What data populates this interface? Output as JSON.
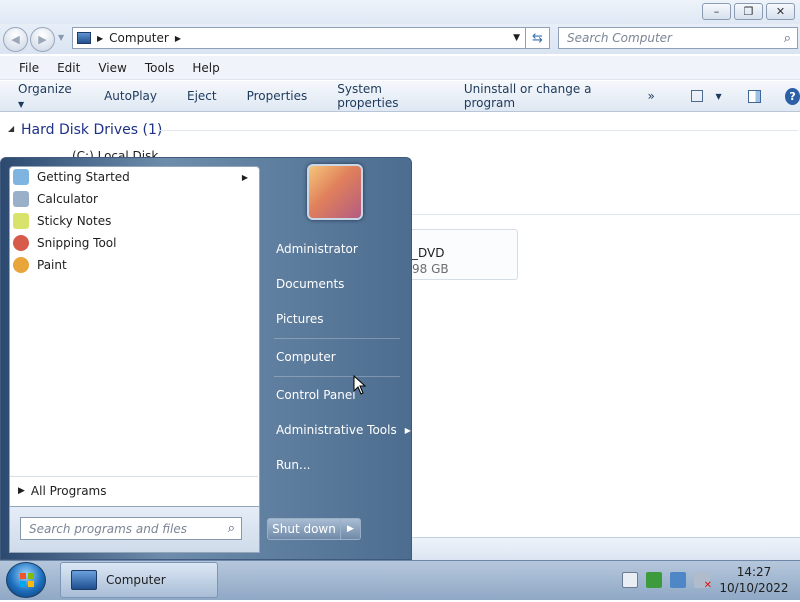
{
  "explorer": {
    "address": {
      "crumb": "Computer"
    },
    "search": {
      "placeholder": "Search Computer"
    },
    "menu": [
      "File",
      "Edit",
      "View",
      "Tools",
      "Help"
    ],
    "commands": [
      "Organize",
      "AutoPlay",
      "Eject",
      "Properties",
      "System properties",
      "Uninstall or change a program"
    ],
    "more": "»",
    "section": {
      "title": "Hard Disk Drives (1)"
    },
    "drive_c": {
      "label": "(C:) Local Disk"
    },
    "drive_dvd": {
      "label": "_DVD",
      "size": "98 GB"
    }
  },
  "start_menu": {
    "programs": [
      {
        "label": "Getting Started",
        "icon": "getting-started-icon",
        "color": "#7fb3e0"
      },
      {
        "label": "Calculator",
        "icon": "calculator-icon",
        "color": "#9ab0c9"
      },
      {
        "label": "Sticky Notes",
        "icon": "sticky-notes-icon",
        "color": "#d8e36c"
      },
      {
        "label": "Snipping Tool",
        "icon": "snipping-tool-icon",
        "color": "#d65b4a"
      },
      {
        "label": "Paint",
        "icon": "paint-icon",
        "color": "#e7a53a"
      }
    ],
    "all_programs": "All Programs",
    "search": {
      "placeholder": "Search programs and files"
    },
    "right": [
      "Administrator",
      "Documents",
      "Pictures",
      "Computer",
      "Control Panel",
      "Administrative Tools",
      "Run..."
    ],
    "shutdown": "Shut down"
  },
  "taskbar": {
    "button": "Computer",
    "time": "14:27",
    "date": "10/10/2022"
  }
}
